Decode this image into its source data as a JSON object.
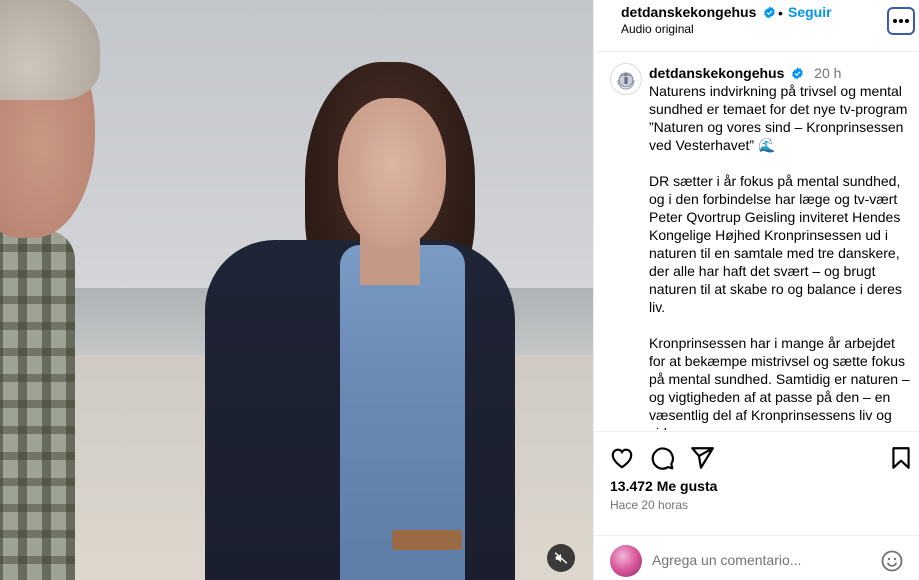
{
  "media": {
    "mute_icon": "speaker-muted-icon"
  },
  "header": {
    "username": "detdanskekongehus",
    "separator": "•",
    "follow_label": "Seguir",
    "audio_label": "Audio original",
    "more_icon": "more-horizontal-icon",
    "verified_color": "#0095f6"
  },
  "caption": {
    "username": "detdanskekongehus",
    "time": "20 h",
    "paragraphs": [
      "Naturens indvirkning på trivsel og mental sundhed er temaet for det nye tv-program ”Naturen og vores sind – Kronprinsessen ved Vesterhavet” 🌊",
      "DR sætter i år fokus på mental sundhed, og i den forbindelse har læge og tv-vært Peter Qvortrup Geisling inviteret Hendes Kongelige Højhed Kronprinsessen ud i naturen til en samtale med tre danskere, der alle har haft det svært – og brugt naturen til at skabe ro og balance i deres liv.",
      "Kronprinsessen har i mange år arbejdet for at bekæmpe mistrivsel og sætte fokus på mental sundhed. Samtidig er naturen – og vigtigheden af at passe på den – en væsentlig del af Kronprinsessens liv og virke."
    ]
  },
  "actions": {
    "like_icon": "heart-icon",
    "comment_icon": "comment-icon",
    "share_icon": "send-icon",
    "save_icon": "bookmark-icon",
    "likes_label": "13.472 Me gusta",
    "time_ago": "Hace 20 horas"
  },
  "comment": {
    "placeholder": "Agrega un comentario...",
    "emoji_icon": "emoji-smile-icon"
  }
}
